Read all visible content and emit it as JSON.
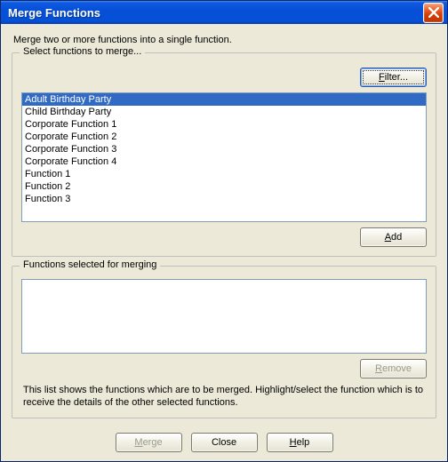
{
  "title": "Merge Functions",
  "close_icon_name": "close-icon",
  "instruction": "Merge two or more functions into a single function.",
  "group_select": {
    "legend": "Select functions to merge...",
    "filter_label": "Filter...",
    "filter_accel": "F",
    "add_label": "Add",
    "add_accel": "A",
    "items": [
      {
        "label": "Adult Birthday Party",
        "selected": true
      },
      {
        "label": "Child Birthday Party",
        "selected": false
      },
      {
        "label": "Corporate Function 1",
        "selected": false
      },
      {
        "label": "Corporate Function 2",
        "selected": false
      },
      {
        "label": "Corporate Function 3",
        "selected": false
      },
      {
        "label": "Corporate Function 4",
        "selected": false
      },
      {
        "label": "Function 1",
        "selected": false
      },
      {
        "label": "Function 2",
        "selected": false
      },
      {
        "label": "Function 3",
        "selected": false
      }
    ]
  },
  "group_selected": {
    "legend": "Functions selected for merging",
    "remove_label": "Remove",
    "remove_accel": "R",
    "remove_enabled": false,
    "items": []
  },
  "help_text": "This list shows the functions which are to be merged.  Highlight/select the function which is to receive the details of the other selected functions.",
  "buttons": {
    "merge": {
      "label": "Merge",
      "accel": "M",
      "enabled": false
    },
    "close": {
      "label": "Close"
    },
    "help": {
      "label": "Help",
      "accel": "H"
    }
  }
}
